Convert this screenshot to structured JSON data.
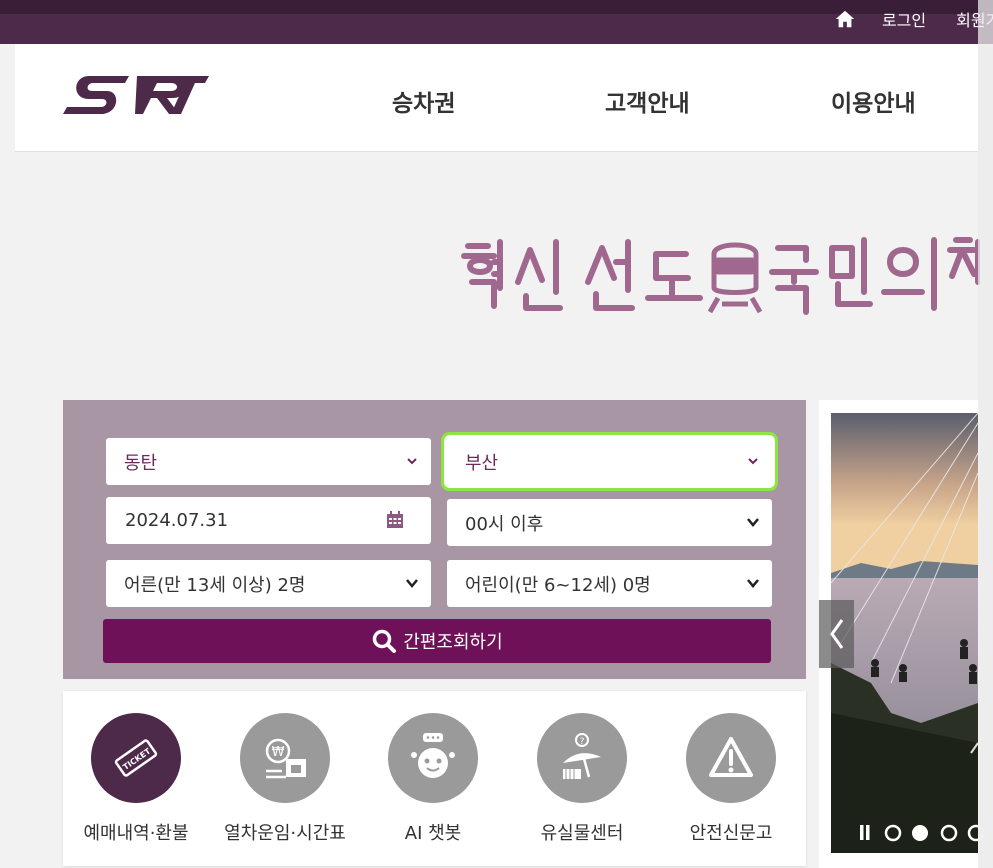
{
  "utility_nav": {
    "login": "로그인",
    "signup": "회원가입"
  },
  "brand": {
    "logo": "SRT",
    "color": "#4e2a4a",
    "accent": "#6f1159"
  },
  "gnb": {
    "items": [
      "승차권",
      "고객안내",
      "이용안내"
    ]
  },
  "hero": {
    "slogan": "혁신 선도 국민의 철도"
  },
  "search": {
    "departure": "동탄",
    "arrival": "부산",
    "date": "2024.07.31",
    "time": "00시 이후",
    "adults": "어른(만 13세 이상) 2명",
    "children": "어린이(만 6~12세) 0명",
    "button_label": "간편조회하기"
  },
  "quick_menu": [
    {
      "label": "예매내역·환불",
      "icon": "ticket-icon",
      "color": "#4e2a4a"
    },
    {
      "label": "열차운임·시간표",
      "icon": "fare-timetable-icon",
      "color": "#9a9a9a"
    },
    {
      "label": "AI 챗봇",
      "icon": "chatbot-icon",
      "color": "#9a9a9a"
    },
    {
      "label": "유실물센터",
      "icon": "lost-found-icon",
      "color": "#9a9a9a"
    },
    {
      "label": "안전신문고",
      "icon": "warning-icon",
      "color": "#9a9a9a"
    }
  ],
  "banner": {
    "active_slide": 2,
    "slide_count": 4
  }
}
